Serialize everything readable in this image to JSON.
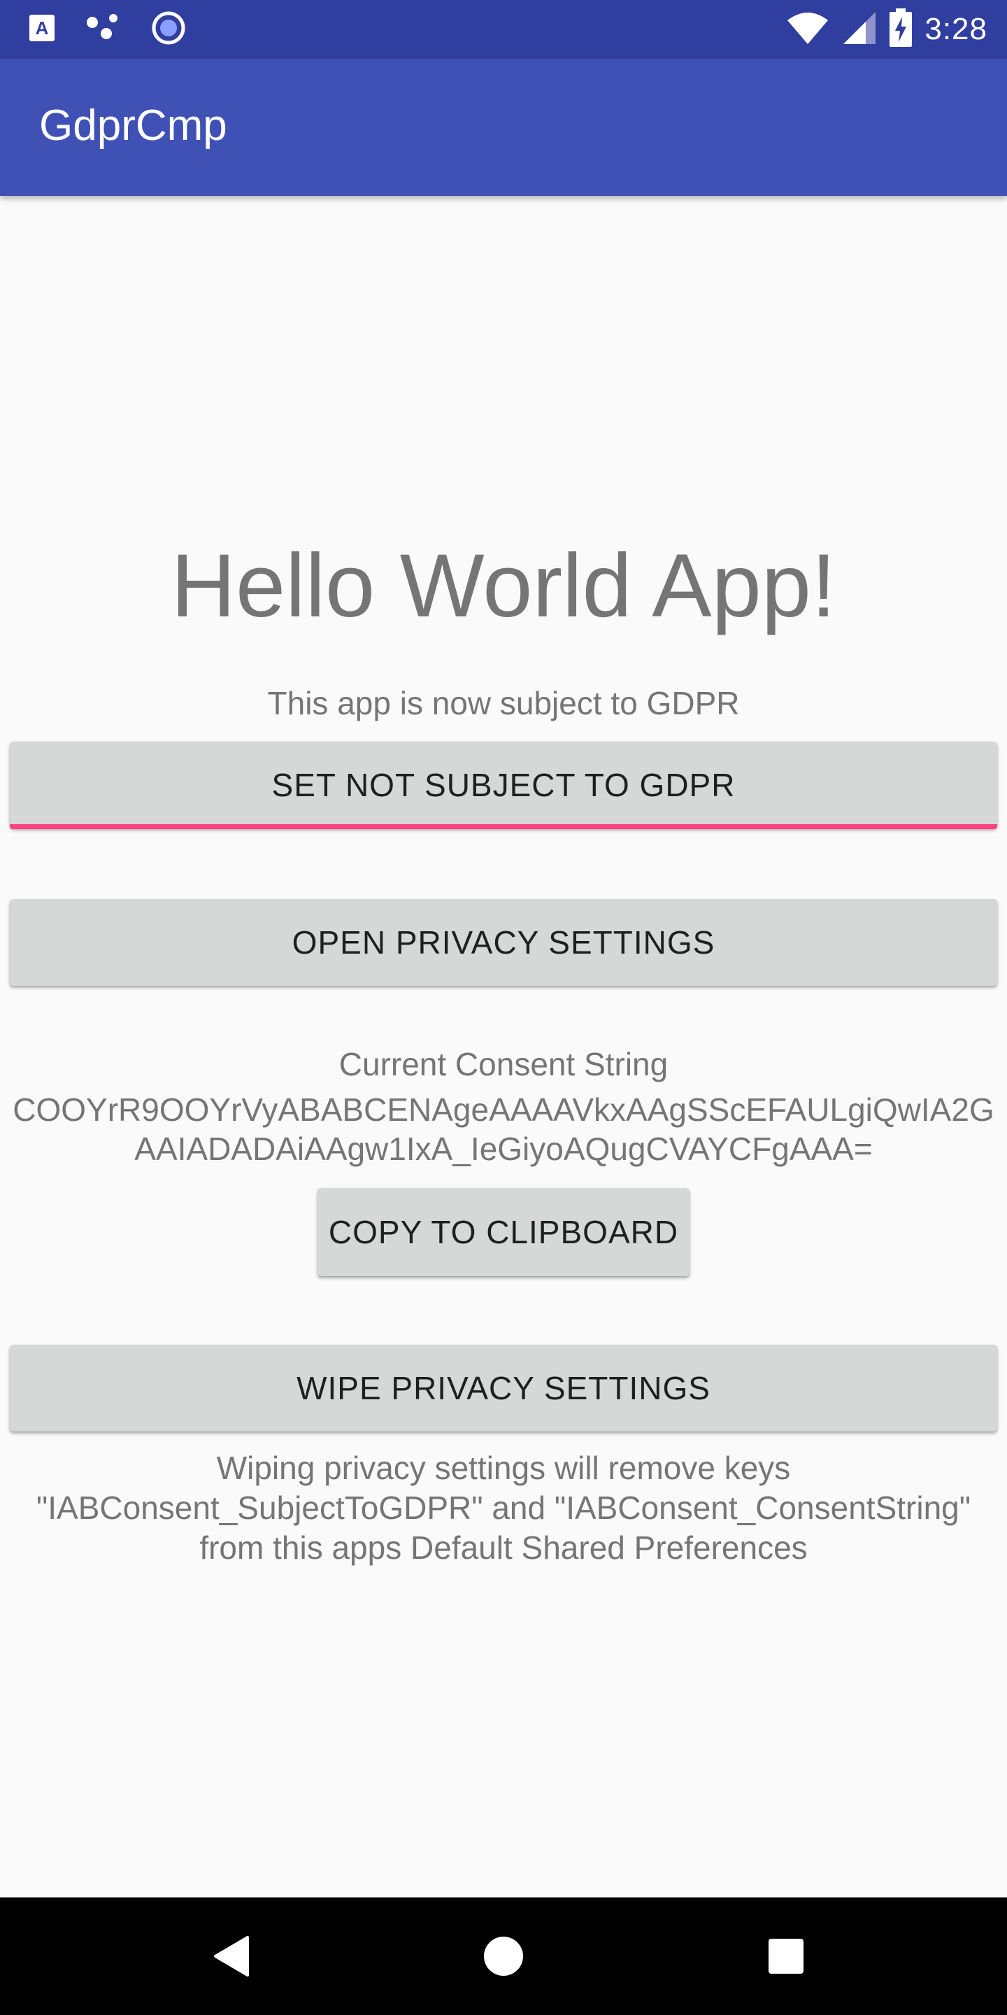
{
  "status_bar": {
    "time": "3:28",
    "left_icons": [
      "font-notification-icon",
      "share-dots-icon",
      "record-circle-icon"
    ],
    "right_icons": [
      "wifi-icon",
      "signal-icon",
      "battery-charging-icon"
    ]
  },
  "app_bar": {
    "title": "GdprCmp"
  },
  "main": {
    "heading": "Hello World App!",
    "subject_status": "This app is now subject to GDPR",
    "set_not_subject_button": "SET NOT SUBJECT TO GDPR",
    "open_privacy_button": "OPEN PRIVACY SETTINGS",
    "consent_label": "Current Consent String",
    "consent_string": "COOYrR9OOYrVyABABCENAgeAAAAVkxAAgSScEFAULgiQwIA2GAAIADADAiAAgw1IxA_IeGiyoAQugCVAYCFgAAA=",
    "copy_button": "COPY TO CLIPBOARD",
    "wipe_button": "WIPE PRIVACY SETTINGS",
    "wipe_note": "Wiping privacy settings will remove keys \"IABConsent_SubjectToGDPR\" and \"IABConsent_ConsentString\" from this apps Default Shared Preferences"
  },
  "nav_bar": {
    "icons": [
      "back-icon",
      "home-icon",
      "recents-icon"
    ]
  },
  "colors": {
    "status_bar": "#303f9f",
    "app_bar": "#3f51b5",
    "accent": "#ff4081",
    "button": "#d6d7d7",
    "background": "#fafafa"
  }
}
